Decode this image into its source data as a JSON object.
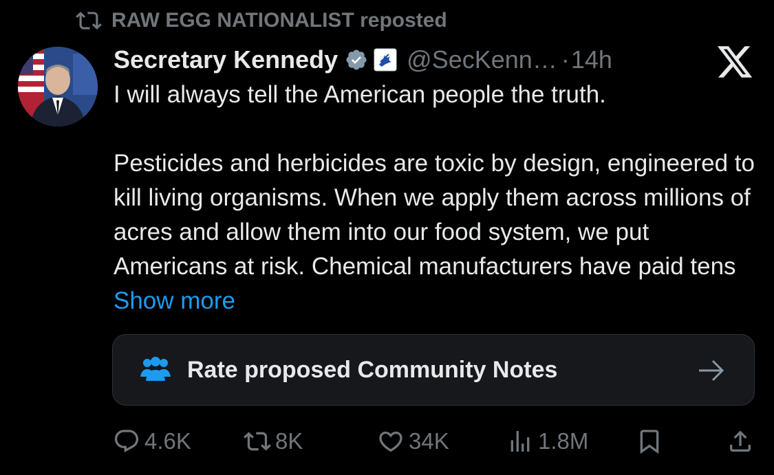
{
  "repost": {
    "label": "RAW EGG NATIONALIST reposted",
    "icon": "retweet-icon"
  },
  "author": {
    "name": "Secretary Kennedy",
    "handle": "@SecKenn…",
    "separator": "·",
    "time": "14h",
    "verified_color": "#829aab",
    "affiliation_icon": "hhs-eagle-icon"
  },
  "tweet": {
    "line1": "I will always tell the American people the truth.",
    "para2": "Pesticides and herbicides are toxic by design, engineered to kill living organisms. When we apply them across millions of acres and allow them into our food system, we put Americans at risk. Chemical manufacturers have paid tens",
    "show_more": "Show more"
  },
  "community_notes": {
    "label": "Rate proposed Community Notes",
    "icon": "people-icon",
    "icon_color": "#1d9bf0"
  },
  "actions": {
    "replies": "4.6K",
    "reposts": "8K",
    "likes": "34K",
    "views": "1.8M"
  },
  "colors": {
    "background": "#000000",
    "text": "#e7e9ea",
    "muted": "#71767b",
    "link": "#1d9bf0",
    "card": "#16181c"
  }
}
